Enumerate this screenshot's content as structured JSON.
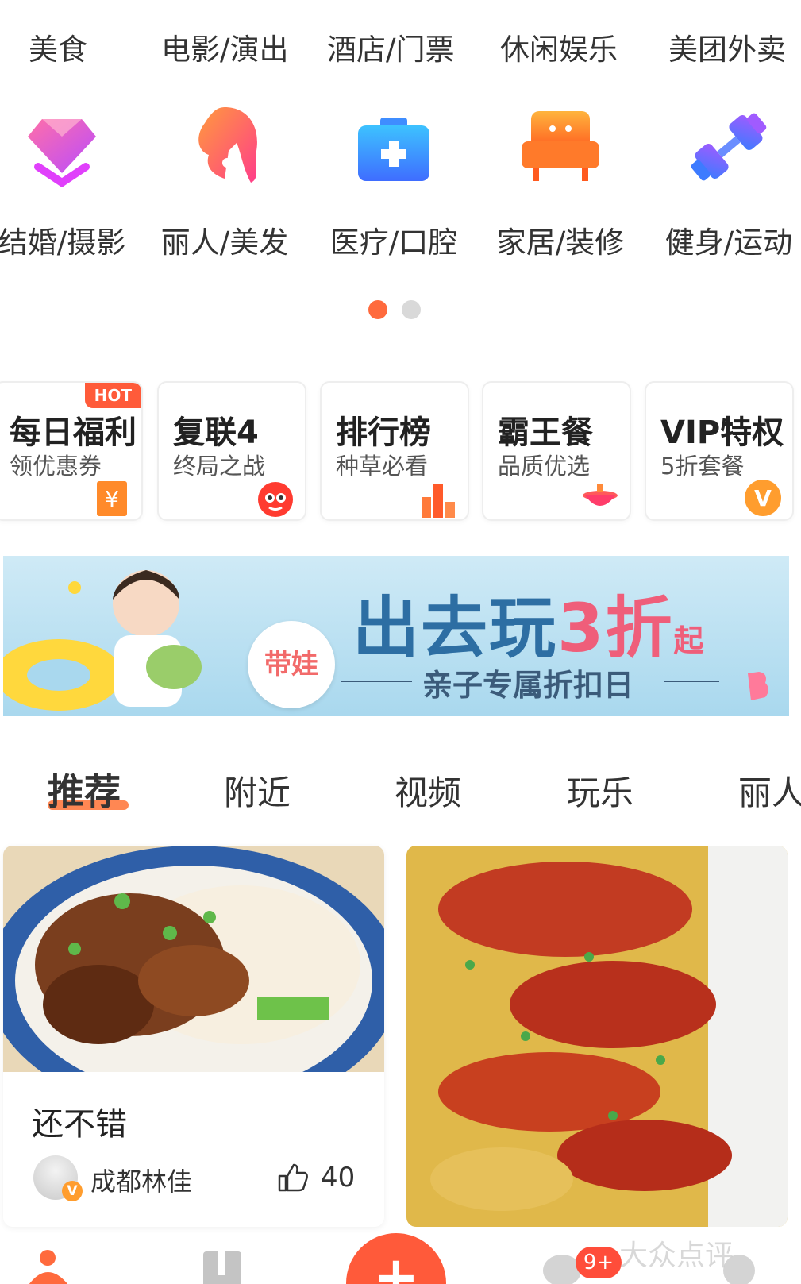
{
  "categories_top": [
    "美食",
    "电影/演出",
    "酒店/门票",
    "休闲娱乐",
    "美团外卖"
  ],
  "categories_icons": [
    {
      "label": "结婚/摄影",
      "icon": "diamond-icon"
    },
    {
      "label": "丽人/美发",
      "icon": "woman-hair-icon"
    },
    {
      "label": "医疗/口腔",
      "icon": "medical-kit-icon"
    },
    {
      "label": "家居/装修",
      "icon": "sofa-icon"
    },
    {
      "label": "健身/运动",
      "icon": "dumbbell-icon"
    }
  ],
  "pager": {
    "active_index": 0,
    "count": 2,
    "active_color": "#ff6a3d",
    "inactive_color": "#d9d9d9"
  },
  "promo_cards": [
    {
      "title": "每日福利",
      "subtitle": "领优惠券",
      "hot": "HOT",
      "icon": "coupon-icon"
    },
    {
      "title": "复联4",
      "subtitle": "终局之战",
      "icon": "cat-logo-icon"
    },
    {
      "title": "排行榜",
      "subtitle": "种草必看",
      "icon": "bar-chart-icon"
    },
    {
      "title": "霸王餐",
      "subtitle": "品质优选",
      "icon": "hotpot-icon"
    },
    {
      "title": "VIP特权",
      "subtitle": "5折套餐",
      "icon": "vip-v-icon"
    }
  ],
  "banner": {
    "tag": "带娃",
    "main_prefix": "出去玩",
    "main_highlight": "3折",
    "main_suffix": "起",
    "sub": "亲子专属折扣日"
  },
  "tabs": [
    {
      "label": "推荐",
      "active": true
    },
    {
      "label": "附近",
      "active": false
    },
    {
      "label": "视频",
      "active": false
    },
    {
      "label": "玩乐",
      "active": false
    },
    {
      "label": "丽人",
      "active": false
    }
  ],
  "feed": [
    {
      "title": "还不错",
      "author": "成都林佳",
      "likes": "40",
      "image": "braised-pork-noodles-photo"
    },
    {
      "image": "garlic-crayfish-photo"
    }
  ],
  "bottom_nav": {
    "message_badge": "9+",
    "plus": "+"
  },
  "watermark": "大众点评",
  "accent_color": "#ff6a3d"
}
